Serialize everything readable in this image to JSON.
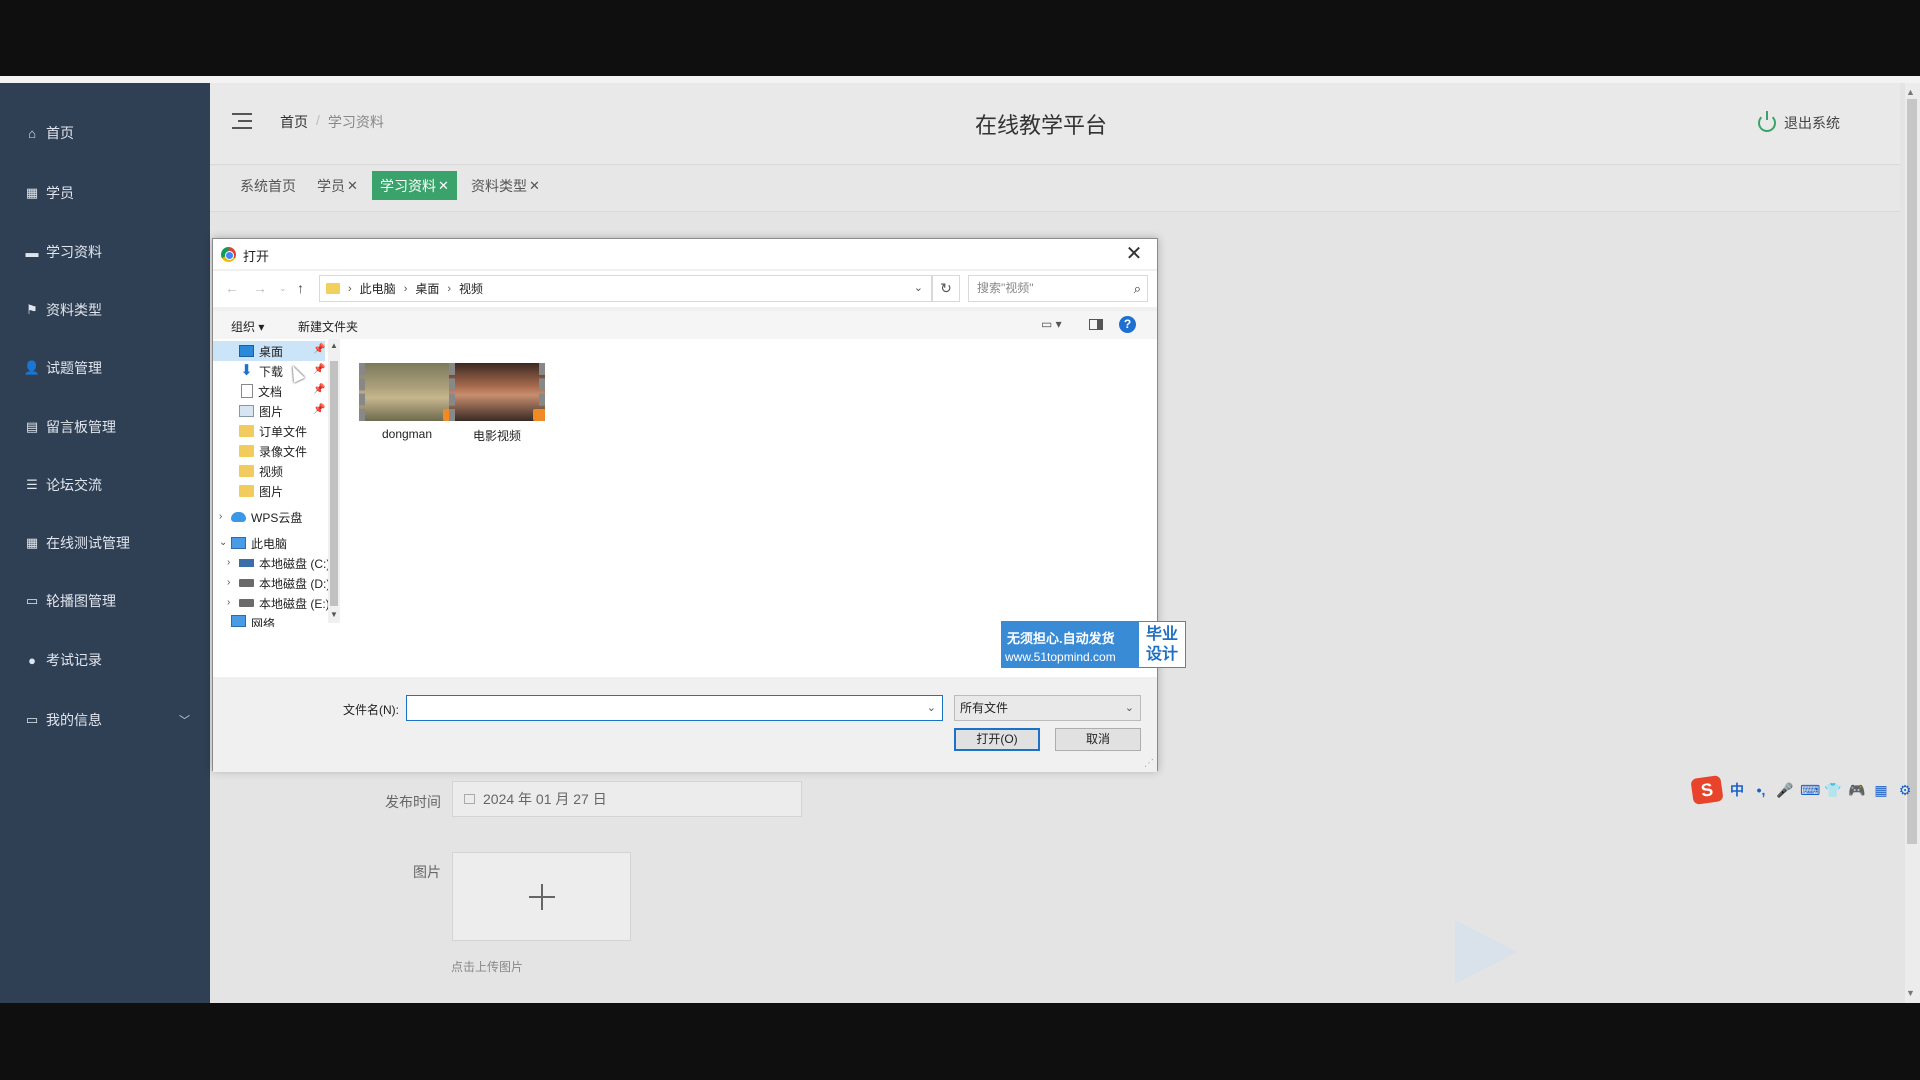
{
  "sidebar": {
    "items": [
      {
        "label": "首页",
        "icon": "home-icon"
      },
      {
        "label": "学员",
        "icon": "grid-icon"
      },
      {
        "label": "学习资料",
        "icon": "book-icon"
      },
      {
        "label": "资料类型",
        "icon": "flag-icon"
      },
      {
        "label": "试题管理",
        "icon": "user-icon"
      },
      {
        "label": "留言板管理",
        "icon": "clipboard-icon"
      },
      {
        "label": "论坛交流",
        "icon": "list-icon"
      },
      {
        "label": "在线测试管理",
        "icon": "grid-icon"
      },
      {
        "label": "轮播图管理",
        "icon": "monitor-icon"
      },
      {
        "label": "考试记录",
        "icon": "pin-icon"
      },
      {
        "label": "我的信息",
        "icon": "id-card-icon"
      }
    ]
  },
  "header": {
    "breadcrumb": {
      "home": "首页",
      "sep": "/",
      "current": "学习资料"
    },
    "title": "在线教学平台",
    "logout": "退出系统"
  },
  "tabs": [
    {
      "label": "系统首页",
      "closable": false
    },
    {
      "label": "学员",
      "closable": true
    },
    {
      "label": "学习资料",
      "closable": true,
      "active": true
    },
    {
      "label": "资料类型",
      "closable": true
    }
  ],
  "tab_close_glyph": "✕",
  "form": {
    "publish_time_label": "发布时间",
    "publish_time_value": "2024 年 01 月 27 日",
    "image_label": "图片",
    "upload_hint": "点击上传图片"
  },
  "dialog": {
    "title": "打开",
    "path": [
      "此电脑",
      "桌面",
      "视频"
    ],
    "search_placeholder": "搜索\"视频\"",
    "organize": "组织 ▾",
    "new_folder": "新建文件夹",
    "help": "?",
    "tree": [
      {
        "label": "桌面",
        "icon": "desktop-icon",
        "selected": true,
        "pinned": true
      },
      {
        "label": "下载",
        "icon": "download-icon",
        "pinned": true
      },
      {
        "label": "文档",
        "icon": "document-icon",
        "pinned": true
      },
      {
        "label": "图片",
        "icon": "picture-icon",
        "pinned": true
      },
      {
        "label": "订单文件",
        "icon": "folder-icon"
      },
      {
        "label": "录像文件",
        "icon": "folder-icon"
      },
      {
        "label": "视频",
        "icon": "folder-icon"
      },
      {
        "label": "图片",
        "icon": "folder-icon"
      },
      {
        "label": "WPS云盘",
        "icon": "cloud-icon"
      },
      {
        "label": "此电脑",
        "icon": "computer-icon"
      },
      {
        "label": "本地磁盘 (C:)",
        "icon": "drive-icon"
      },
      {
        "label": "本地磁盘 (D:)",
        "icon": "drive-icon"
      },
      {
        "label": "本地磁盘 (E:)",
        "icon": "drive-icon"
      },
      {
        "label": "网络",
        "icon": "network-icon"
      }
    ],
    "files": [
      {
        "name": "dongman"
      },
      {
        "name": "电影视频"
      }
    ],
    "ad": {
      "line1": "无须担心.自动发货",
      "line2": "www.51topmind.com",
      "badge": "毕业设计"
    },
    "filename_label": "文件名(N):",
    "filename_value": "",
    "filetype": "所有文件",
    "open_button": "打开(O)",
    "cancel_button": "取消"
  },
  "ime": {
    "logo": "S",
    "items": [
      "中",
      "•,",
      "🎤",
      "⌨",
      "👕",
      "🎮",
      "▦",
      "⚙"
    ]
  }
}
